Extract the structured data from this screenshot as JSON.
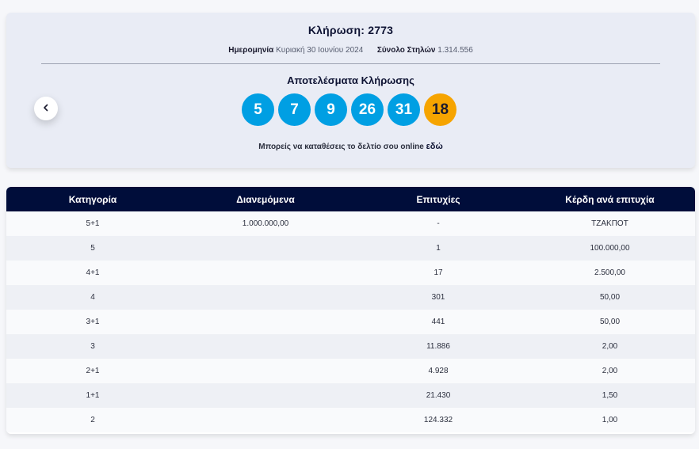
{
  "draw": {
    "title": "Κλήρωση: 2773",
    "date_label": "Ημερομηνία",
    "date_value": "Κυριακή 30 Ιουνίου 2024",
    "columns_label": "Σύνολο Στηλών",
    "columns_value": "1.314.556",
    "results_title": "Αποτελέσματα Κλήρωσης",
    "numbers": [
      "5",
      "7",
      "9",
      "26",
      "31"
    ],
    "bonus": "18",
    "online_text": "Μπορείς να καταθέσεις το δελτίο σου online",
    "online_link": "εδώ",
    "colors": {
      "main_ball": "#009fe3",
      "bonus_ball": "#f6a400",
      "header": "#000d3a"
    }
  },
  "table": {
    "headers": [
      "Κατηγορία",
      "Διανεμόμενα",
      "Επιτυχίες",
      "Κέρδη ανά επιτυχία"
    ],
    "rows": [
      [
        "5+1",
        "1.000.000,00",
        "-",
        "ΤΖΑΚΠΟΤ"
      ],
      [
        "5",
        "",
        "1",
        "100.000,00"
      ],
      [
        "4+1",
        "",
        "17",
        "2.500,00"
      ],
      [
        "4",
        "",
        "301",
        "50,00"
      ],
      [
        "3+1",
        "",
        "441",
        "50,00"
      ],
      [
        "3",
        "",
        "11.886",
        "2,00"
      ],
      [
        "2+1",
        "",
        "4.928",
        "2,00"
      ],
      [
        "1+1",
        "",
        "21.430",
        "1,50"
      ],
      [
        "2",
        "",
        "124.332",
        "1,00"
      ]
    ]
  }
}
